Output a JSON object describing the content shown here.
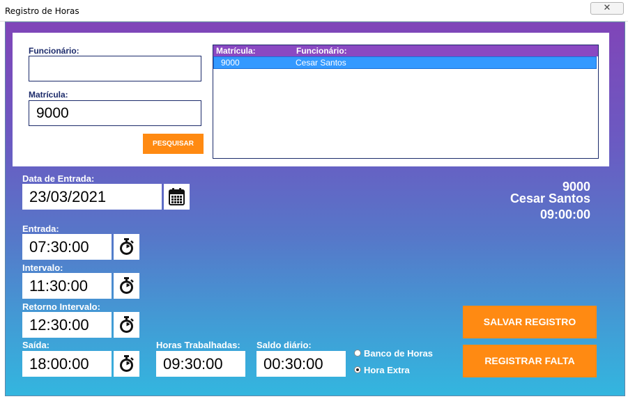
{
  "window": {
    "title": "Registro de Horas",
    "close_glyph": "✕"
  },
  "search": {
    "funcionario_label": "Funcionário:",
    "funcionario_value": "",
    "matricula_label": "Matrícula:",
    "matricula_value": "9000",
    "search_button": "PESQUISAR"
  },
  "results": {
    "columns": [
      "Matrícula:",
      "Funcionário:"
    ],
    "rows": [
      {
        "matricula": "9000",
        "funcionario": "Cesar Santos"
      }
    ]
  },
  "entry": {
    "date_label": "Data de Entrada:",
    "date_value": "23/03/2021",
    "entrada_label": "Entrada:",
    "entrada_value": "07:30:00",
    "intervalo_label": "Intervalo:",
    "intervalo_value": "11:30:00",
    "retorno_label": "Retorno Intervalo:",
    "retorno_value": "12:30:00",
    "saida_label": "Saída:",
    "saida_value": "18:00:00",
    "horas_label": "Horas Trabalhadas:",
    "horas_value": "09:30:00",
    "saldo_label": "Saldo diário:",
    "saldo_value": "00:30:00"
  },
  "employee_info": {
    "matricula": "9000",
    "name": "Cesar Santos",
    "hours": "09:00:00"
  },
  "options": {
    "banco_label": "Banco de Horas",
    "hora_extra_label": "Hora Extra",
    "selected": "Hora Extra"
  },
  "actions": {
    "save": "SALVAR REGISTRO",
    "absence": "REGISTRAR FALTA"
  },
  "colors": {
    "accent_orange": "#ff8a12",
    "header_purple": "#8a49c2",
    "selection_blue": "#3399ff",
    "label_navy": "#1b2a6a"
  },
  "icons": {
    "date_picker": "calendar-icon",
    "time_pickers": "stopwatch-icon"
  }
}
